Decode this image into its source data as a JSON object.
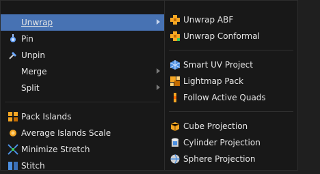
{
  "left_menu": {
    "items": [
      {
        "label": "Unwrap",
        "icon": "none",
        "has_submenu": true,
        "active": true
      },
      {
        "label": "Pin",
        "icon": "pin-icon"
      },
      {
        "label": "Unpin",
        "icon": "unpin-icon"
      },
      {
        "label": "Merge",
        "icon": "none",
        "has_submenu": true
      },
      {
        "label": "Split",
        "icon": "none",
        "has_submenu": true
      },
      {
        "label": "Pack Islands",
        "icon": "pack-islands-icon"
      },
      {
        "label": "Average Islands Scale",
        "icon": "average-islands-scale-icon"
      },
      {
        "label": "Minimize Stretch",
        "icon": "minimize-stretch-icon"
      },
      {
        "label": "Stitch",
        "icon": "stitch-icon"
      }
    ]
  },
  "right_menu": {
    "items": [
      {
        "label": "Unwrap ABF",
        "icon": "unwrap-abf-icon"
      },
      {
        "label": "Unwrap Conformal",
        "icon": "unwrap-conformal-icon"
      },
      {
        "label": "Smart UV Project",
        "icon": "smart-uv-project-icon"
      },
      {
        "label": "Lightmap Pack",
        "icon": "lightmap-pack-icon"
      },
      {
        "label": "Follow Active Quads",
        "icon": "follow-active-quads-icon"
      },
      {
        "label": "Cube Projection",
        "icon": "cube-projection-icon"
      },
      {
        "label": "Cylinder Projection",
        "icon": "cylinder-projection-icon"
      },
      {
        "label": "Sphere Projection",
        "icon": "sphere-projection-icon"
      }
    ]
  },
  "colors": {
    "highlight": "#4772b3",
    "background": "#181818",
    "text": "#e6e6e6",
    "icon_orange": "#f5a623",
    "icon_blue": "#4c8fe0",
    "icon_green": "#3cc65a"
  }
}
